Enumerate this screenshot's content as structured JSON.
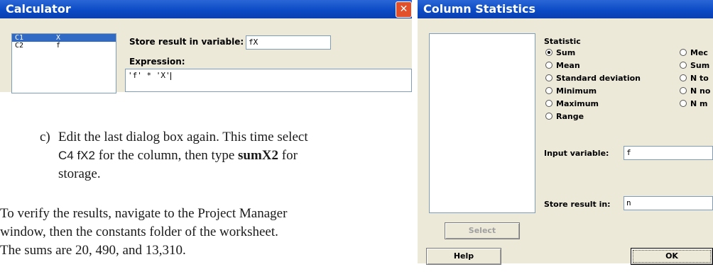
{
  "calculator": {
    "title": "Calculator",
    "columns": [
      {
        "id": "C1",
        "name": "X"
      },
      {
        "id": "C2",
        "name": "f"
      }
    ],
    "store_label": "Store result in variable:",
    "store_value": "fX",
    "expression_label": "Expression:",
    "expression_value": "'f' * 'X'"
  },
  "instructions": {
    "step_marker": "c)",
    "step_text_1": "Edit the last dialog box again. This time select",
    "step_text_2a": "C4 fX2",
    "step_text_2b": " for the column, then type ",
    "step_text_2c": "sumX2",
    "step_text_2d": " for",
    "step_text_3": "storage.",
    "verify_1": "To verify the results, navigate to the Project Manager",
    "verify_2": "window, then the constants folder of the worksheet.",
    "verify_3": "The sums are 20, 490, and 13,310."
  },
  "column_stats": {
    "title": "Column Statistics",
    "statistic_label": "Statistic",
    "options_left": [
      "Sum",
      "Mean",
      "Standard deviation",
      "Minimum",
      "Maximum",
      "Range"
    ],
    "options_right": [
      "Mec",
      "Sum",
      "N to",
      "N no",
      "N m"
    ],
    "selected": "Sum",
    "input_label": "Input variable:",
    "input_value": "f",
    "store_label": "Store result in:",
    "store_value": "n",
    "select_button": "Select",
    "help_button": "Help",
    "ok_button": "OK"
  }
}
